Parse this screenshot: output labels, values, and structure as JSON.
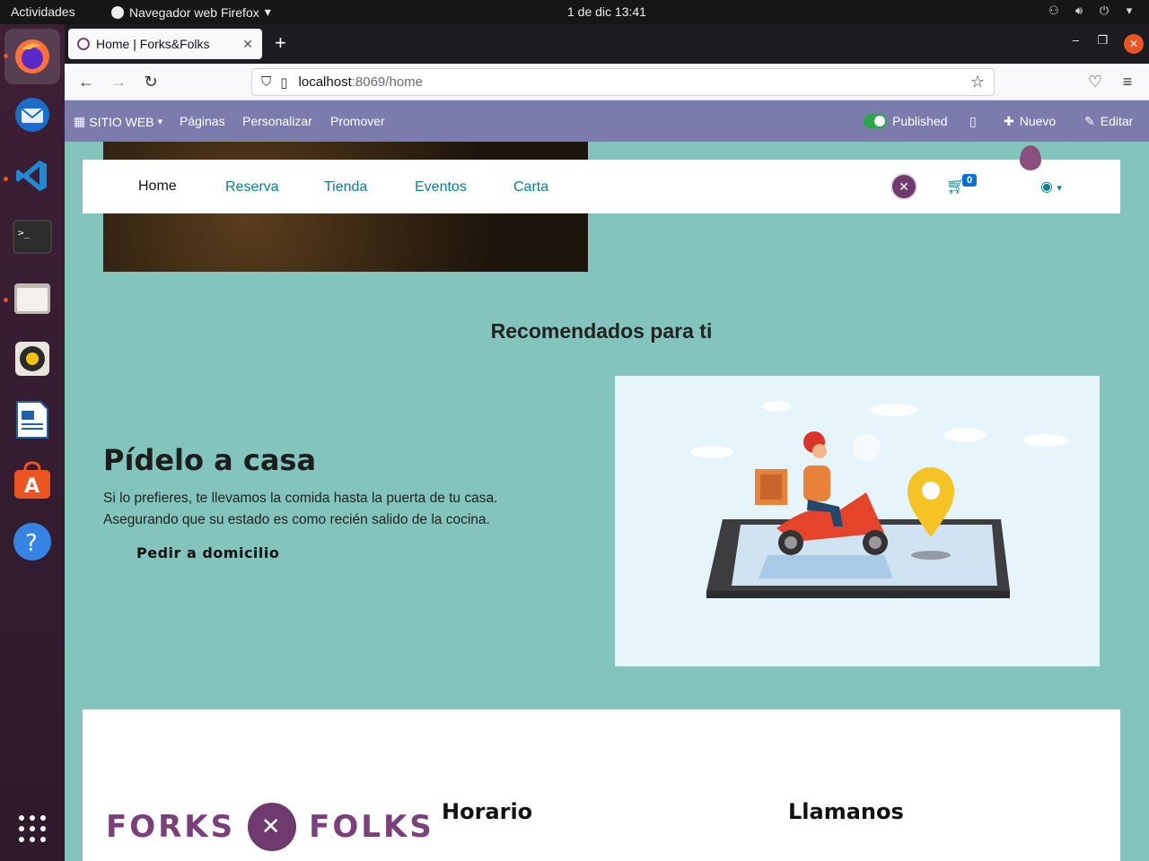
{
  "system": {
    "activities": "Actividades",
    "app_menu": "Navegador web Firefox",
    "clock": "1 de dic  13:41"
  },
  "browser": {
    "tab_title": "Home | Forks&Folks",
    "url_host": "localhost",
    "url_rest": ":8069/home"
  },
  "odoo_bar": {
    "website_menu": "SITIO WEB",
    "pages": "Páginas",
    "customize": "Personalizar",
    "promote": "Promover",
    "published": "Published",
    "new": "Nuevo",
    "edit": "Editar"
  },
  "site_nav": {
    "links": [
      "Home",
      "Reserva",
      "Tienda",
      "Eventos",
      "Carta"
    ],
    "cart_count": "0"
  },
  "section": {
    "title": "Recomendados para ti"
  },
  "promo": {
    "title": "Pídelo a casa",
    "line1": "Si lo prefieres, te llevamos la comida hasta la puerta de tu casa.",
    "line2": "Asegurando que su estado es como recién salido de la cocina.",
    "button": "Pedir a domicilio"
  },
  "footer": {
    "logo_left": "FORKS",
    "logo_right": "FOLKS",
    "schedule_title": "Horario",
    "contact_title": "Llamanos"
  },
  "colors": {
    "page_bg": "#83c4bd",
    "odoo_bar": "#7c7bad",
    "brand_purple": "#6f3a6e",
    "link_teal": "#0a7f8c"
  }
}
